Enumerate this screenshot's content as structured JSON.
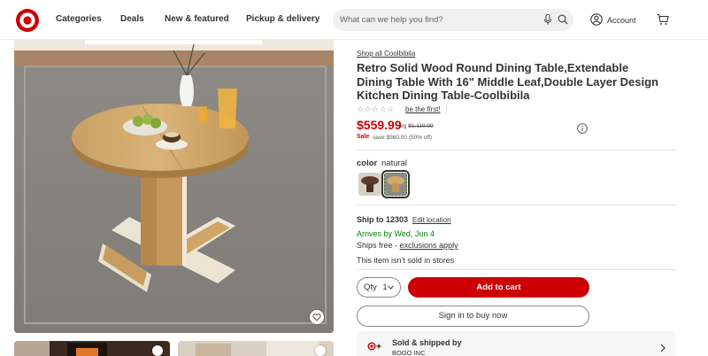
{
  "header": {
    "logo": "target-bullseye-logo",
    "nav": [
      {
        "label": "Categories"
      },
      {
        "label": "Deals"
      },
      {
        "label": "New & featured"
      },
      {
        "label": "Pickup & delivery"
      }
    ],
    "search": {
      "placeholder": "What can we help you find?"
    },
    "account_label": "Account"
  },
  "gallery": {
    "main_image": "round-wood-dining-table-photo",
    "favorite_icon": "heart-icon",
    "thumbnails": [
      "fireplace-room-thumbnail",
      "table-room-thumbnail"
    ]
  },
  "product": {
    "shop_link": "Shop all Coolbibila",
    "title": "Retro Solid Wood Round Dining Table,Extendable Dining Table With 16\" Middle Leaf,Double Layer Design Kitchen Dining Table-Coolbibila",
    "stars": "☆☆☆☆☆",
    "rating_link": "be the first!",
    "price": "$559.99",
    "reg_prefix": "reg",
    "reg_price": "$1,119.99",
    "sale_label": "Sale",
    "save_text": "save $560.00 (50% off)",
    "color_label": "color",
    "color_value": "natural",
    "swatches": [
      {
        "name": "dark-walnut",
        "selected": false
      },
      {
        "name": "natural",
        "selected": true
      }
    ]
  },
  "fulfillment": {
    "ship_to": "Ship to 12303",
    "edit_location": "Edit location",
    "arrives": "Arrives by Wed, Jun 4",
    "ships_free_prefix": "Ships free - ",
    "exclusions": "exclusions apply",
    "not_sold": "This item isn't sold in stores"
  },
  "purchase": {
    "qty_label": "Qty",
    "qty_value": "1",
    "add_to_cart": "Add to cart",
    "sign_in": "Sign in to buy now"
  },
  "seller": {
    "title": "Sold & shipped by",
    "name": "BOGO INC"
  },
  "colors": {
    "brand_red": "#cc0000",
    "green": "#008300"
  }
}
